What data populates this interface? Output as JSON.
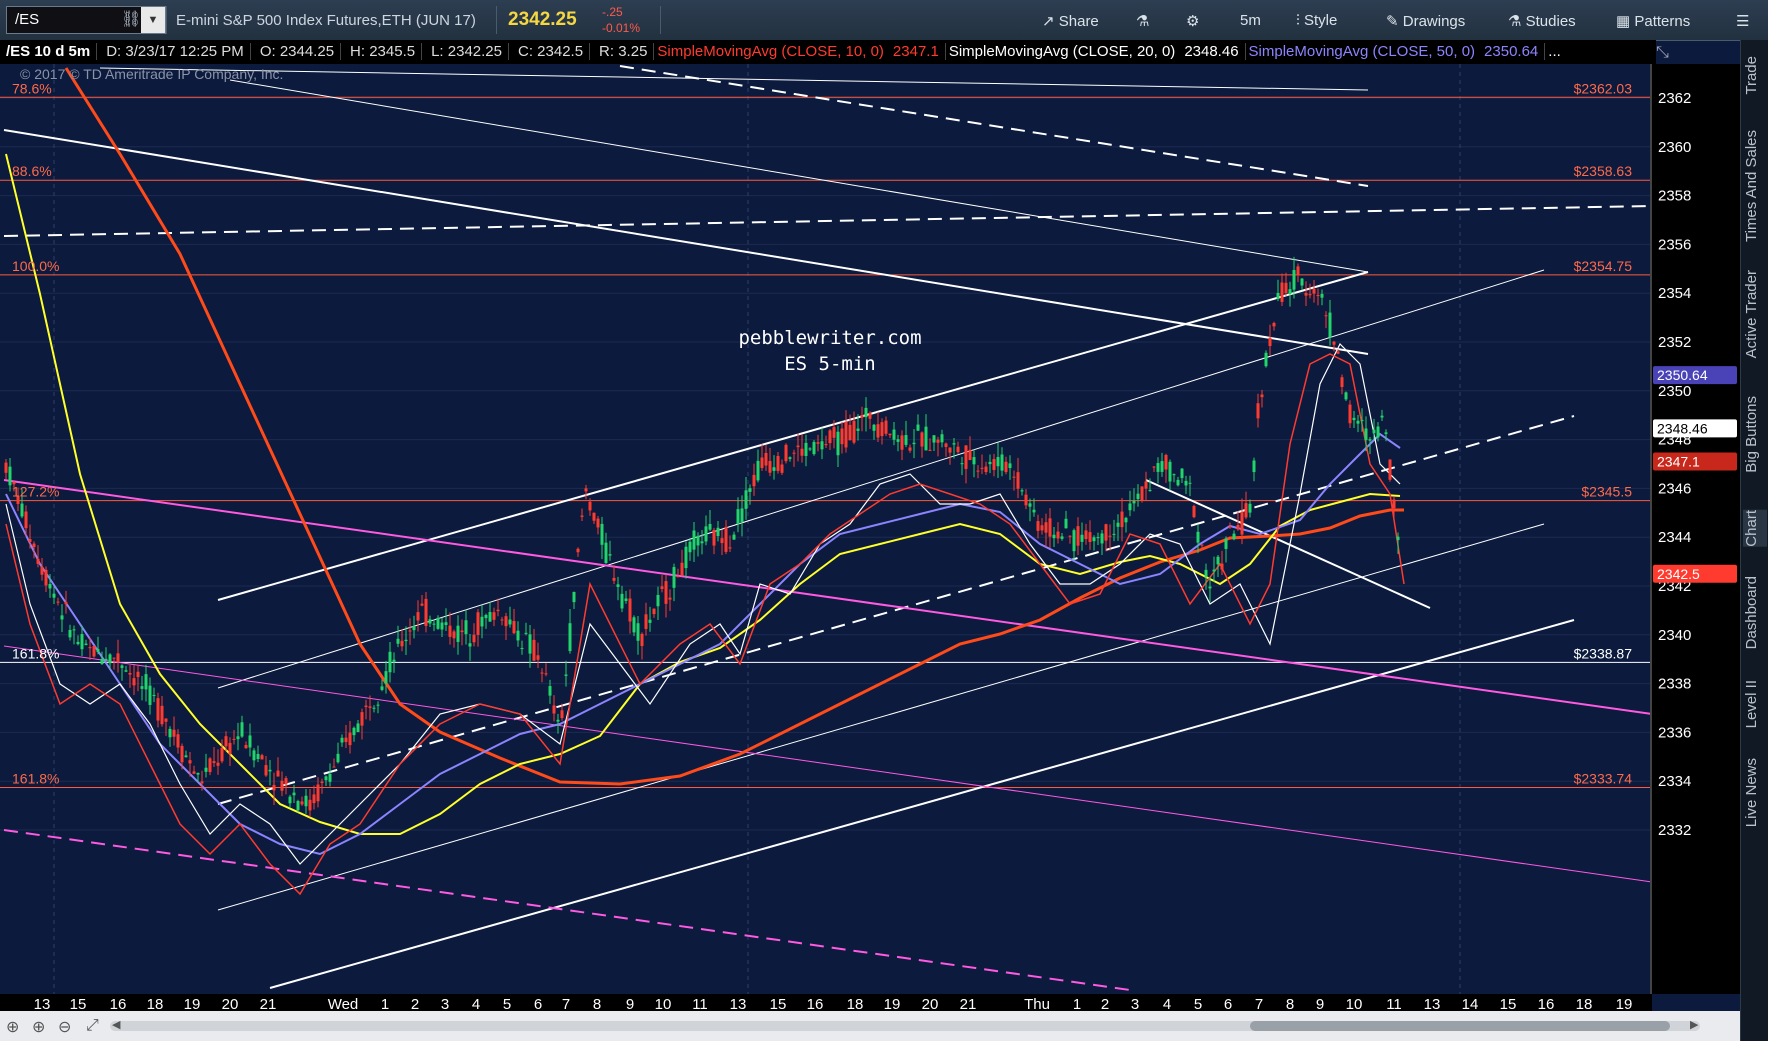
{
  "toolbar": {
    "symbol": "/ES",
    "instrument_name": "E-mini S&P 500 Index Futures,ETH (JUN 17)",
    "last_price": "2342.25",
    "change_abs": "-.25",
    "change_pct": "-0.01%",
    "share_label": "Share",
    "timeframe_label": "5m",
    "style_label": "Style",
    "drawings_label": "Drawings",
    "studies_label": "Studies",
    "patterns_label": "Patterns"
  },
  "infobar": {
    "symbol_period": "/ES 10 d 5m",
    "date": "D: 3/23/17 12:25 PM",
    "open": "O: 2344.25",
    "high": "H: 2345.5",
    "low": "L: 2342.25",
    "close": "C: 2342.5",
    "range": "R: 3.25",
    "sma10_label": "SimpleMovingAvg (CLOSE, 10, 0)",
    "sma10_value": "2347.1",
    "sma20_label": "SimpleMovingAvg (CLOSE, 20, 0)",
    "sma20_value": "2348.46",
    "sma50_label": "SimpleMovingAvg (CLOSE, 50, 0)",
    "sma50_value": "2350.64",
    "more": "..."
  },
  "chart": {
    "copyright": "© 2017 © TD Ameritrade IP Company, Inc.",
    "watermark_line1": "pebblewriter.com",
    "watermark_line2": "ES 5-min",
    "colors": {
      "background": "#0b1a3d",
      "sma10": "#ff3b2f",
      "sma20": "#ffffff",
      "sma50": "#8c84ff",
      "sma_yellow": "#ffff2a",
      "sma_orange": "#ff4a1a",
      "fib": "#ff5a3c",
      "magenta": "#ff5ae0"
    },
    "fib_levels": [
      {
        "pct": "78.6%",
        "price": "$2362.03",
        "value": 2362.03
      },
      {
        "pct": "88.6%",
        "price": "$2358.63",
        "value": 2358.63
      },
      {
        "pct": "100.0%",
        "price": "$2354.75",
        "value": 2354.75
      },
      {
        "pct": "127.2%",
        "price": "$2345.5",
        "value": 2345.5
      },
      {
        "pct": "161.8%",
        "price": "$2338.87",
        "value": 2338.87,
        "white": true
      },
      {
        "pct": "161.8%",
        "price": "$2333.74",
        "value": 2333.74
      }
    ],
    "y_ticks": [
      "2362",
      "2360",
      "2358",
      "2356",
      "2354",
      "2352",
      "2350",
      "2348",
      "2346",
      "2344",
      "2342",
      "2340",
      "2338",
      "2336",
      "2334",
      "2332"
    ],
    "x_ticks": [
      "13",
      "15",
      "16",
      "18",
      "19",
      "20",
      "21",
      "Wed",
      "1",
      "2",
      "3",
      "4",
      "5",
      "6",
      "7",
      "8",
      "9",
      "10",
      "11",
      "13",
      "15",
      "16",
      "18",
      "19",
      "20",
      "21",
      "Thu",
      "1",
      "2",
      "3",
      "4",
      "5",
      "6",
      "7",
      "8",
      "9",
      "10",
      "11",
      "13",
      "14",
      "15",
      "16",
      "18",
      "19"
    ],
    "price_bubbles": [
      {
        "value": "2350.64",
        "kind": "sma50"
      },
      {
        "value": "2348.46",
        "kind": "sma20"
      },
      {
        "value": "2347.1",
        "kind": "sma10"
      },
      {
        "value": "2342.5",
        "kind": "last"
      }
    ]
  },
  "right_rail": {
    "tabs": [
      "Trade",
      "Times And Sales",
      "Active Trader",
      "Big Buttons",
      "Chart",
      "Dashboard",
      "Level II",
      "Live News"
    ]
  }
}
